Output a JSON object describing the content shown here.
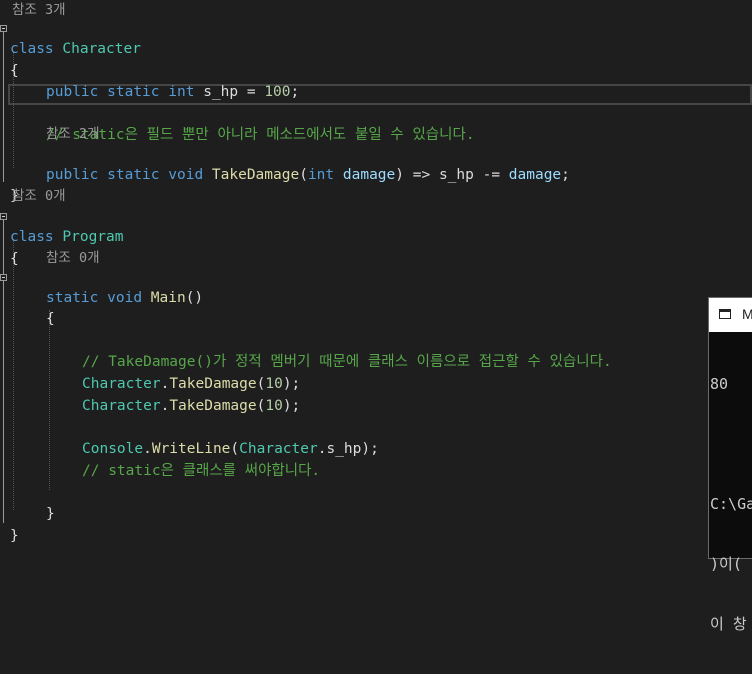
{
  "editor": {
    "ref_count_3": "참조 3개",
    "ref_count_0a": "참조 0개",
    "ref_count_0b": "참조 0개",
    "ref_count_2": "참조 2개",
    "kw_class": "class",
    "kw_public": "public",
    "kw_static": "static",
    "kw_int": "int",
    "kw_void": "void",
    "class_character": "Character",
    "class_program": "Program",
    "class_console": "Console",
    "field_s_hp": "s_hp",
    "method_takedamage": "TakeDamage",
    "method_main": "Main",
    "method_writeline": "WriteLine",
    "param_damage": "damage",
    "num_100": "100",
    "num_10": "10",
    "brace_open": "{",
    "brace_close": "}",
    "comment_static_methods": "// static은 필드 뿐만 아니라 메소드에서도 붙일 수 있습니다.",
    "comment_access_by_class": "// TakeDamage()가 정적 멤버기 때문에 클래스 이름으로 접근할 수 있습니다.",
    "comment_use_class": "// static은 클래스를 써야합니다."
  },
  "console": {
    "title": "M",
    "lines": [
      "80",
      "",
      "C:\\Ga",
      ")이(",
      "이 창"
    ]
  }
}
